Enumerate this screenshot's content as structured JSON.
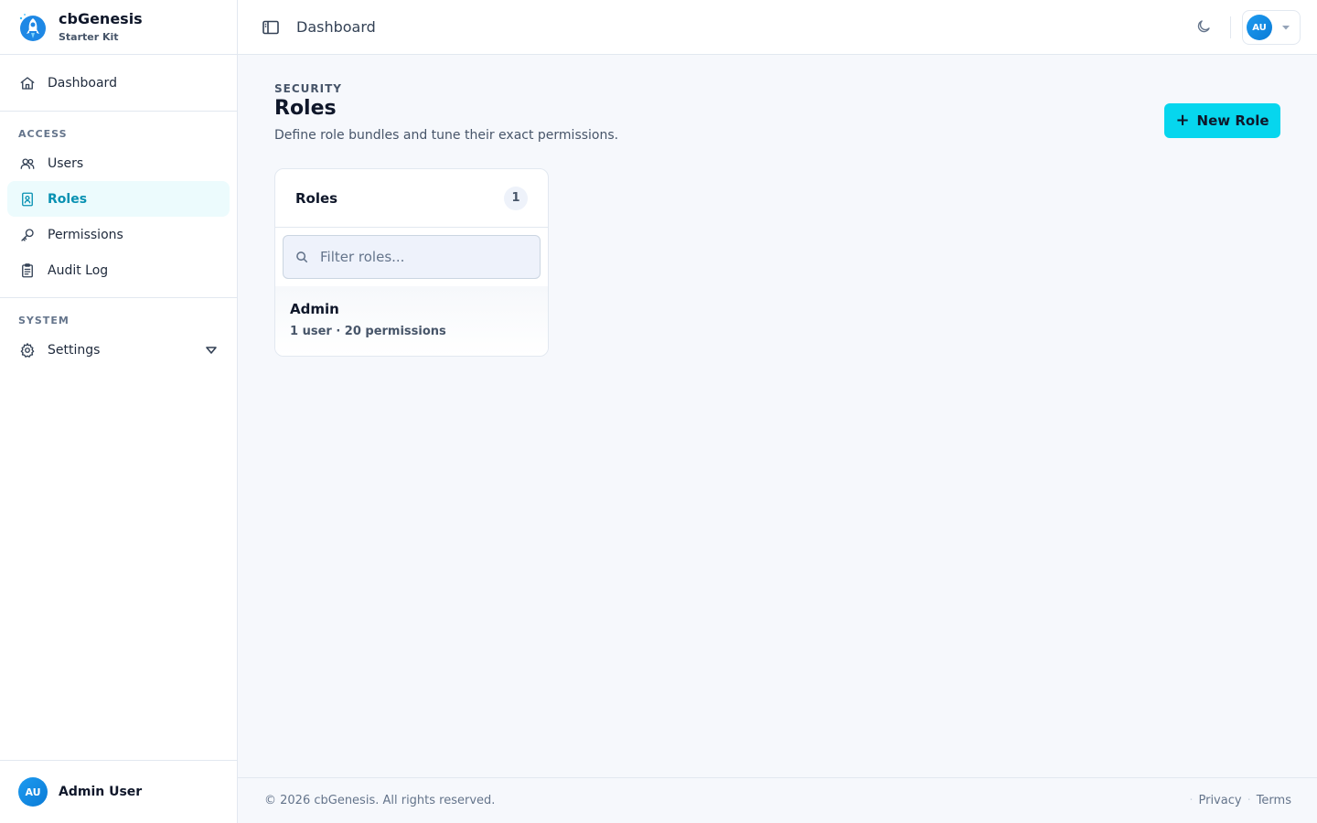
{
  "brand": {
    "name": "cbGenesis",
    "subtitle": "Starter Kit"
  },
  "sidebar": {
    "top_items": [
      {
        "label": "Dashboard",
        "icon": "home-icon"
      }
    ],
    "access": {
      "label": "ACCESS",
      "items": [
        {
          "label": "Users",
          "icon": "users-icon"
        },
        {
          "label": "Roles",
          "icon": "id-badge-icon",
          "active": true
        },
        {
          "label": "Permissions",
          "icon": "key-icon"
        },
        {
          "label": "Audit Log",
          "icon": "clipboard-icon"
        }
      ]
    },
    "system": {
      "label": "SYSTEM",
      "items": [
        {
          "label": "Settings",
          "icon": "gear-icon",
          "expandable": true
        }
      ]
    },
    "user": {
      "initials": "AU",
      "name": "Admin User"
    }
  },
  "header": {
    "title": "Dashboard",
    "user_initials": "AU"
  },
  "page": {
    "eyebrow": "SECURITY",
    "title": "Roles",
    "description": "Define role bundles and tune their exact permissions.",
    "new_button": "New Role"
  },
  "roles_panel": {
    "title": "Roles",
    "count": "1",
    "filter_placeholder": "Filter roles...",
    "items": [
      {
        "name": "Admin",
        "meta": "1 user · 20 permissions"
      }
    ]
  },
  "footer": {
    "copyright": "© 2026 cbGenesis. All rights reserved.",
    "links": [
      "Privacy",
      "Terms"
    ]
  },
  "colors": {
    "accent": "#06d6ee",
    "active_text": "#0891b2",
    "active_bg": "#ecfbfd",
    "avatar": "#1d9bf0"
  }
}
